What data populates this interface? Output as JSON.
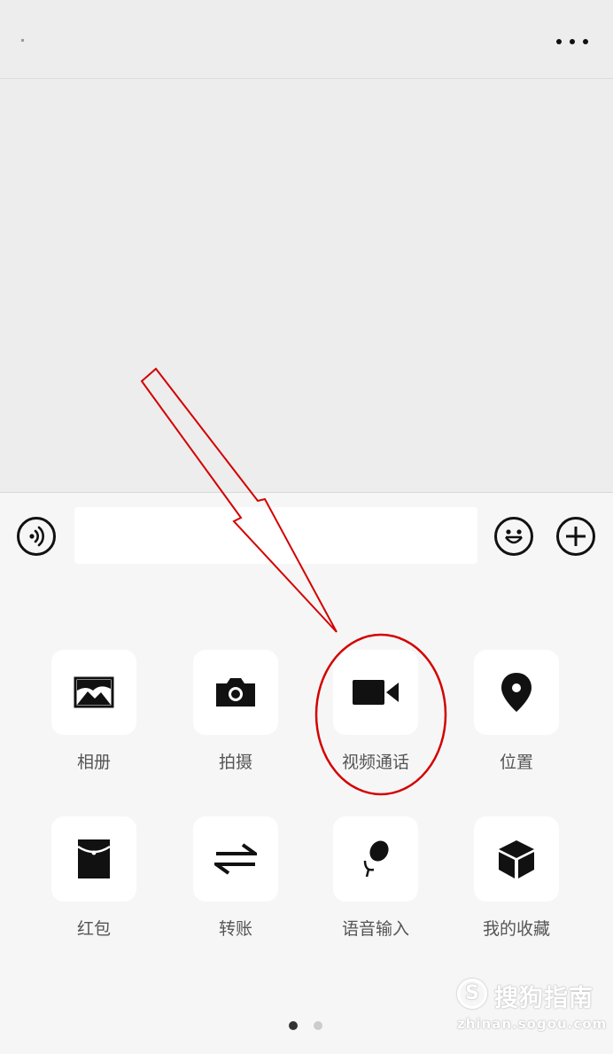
{
  "header": {
    "title": "",
    "more_icon": "more-dots-icon"
  },
  "input_bar": {
    "voice_icon": "voice-icon",
    "text_value": "",
    "emoji_icon": "emoji-icon",
    "plus_icon": "plus-icon"
  },
  "panel": {
    "items": [
      {
        "label": "相册",
        "icon": "photo-album-icon"
      },
      {
        "label": "拍摄",
        "icon": "camera-icon"
      },
      {
        "label": "视频通话",
        "icon": "video-call-icon"
      },
      {
        "label": "位置",
        "icon": "location-icon"
      },
      {
        "label": "红包",
        "icon": "red-packet-icon"
      },
      {
        "label": "转账",
        "icon": "transfer-icon"
      },
      {
        "label": "语音输入",
        "icon": "microphone-icon"
      },
      {
        "label": "我的收藏",
        "icon": "favorites-icon"
      }
    ],
    "pages": 2,
    "current_page": 1
  },
  "colors": {
    "background": "#ededed",
    "panel": "#f6f6f6",
    "icon": "#111111",
    "label": "#555555",
    "annotation": "#d40000",
    "page_dot_active": "#333333",
    "page_dot_inactive": "#cccccc"
  },
  "watermark": {
    "logo_letter": "S",
    "text": "搜狗指南",
    "url": "zhinan.sogou.com"
  }
}
